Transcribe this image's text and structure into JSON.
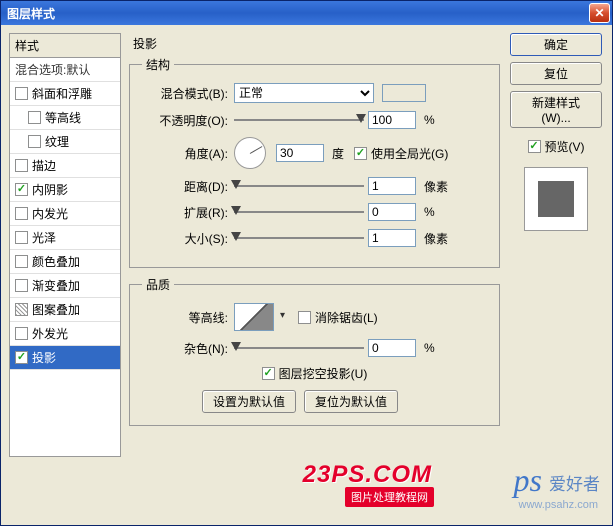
{
  "window": {
    "title": "图层样式"
  },
  "left": {
    "header": "样式",
    "blending_default": "混合选项:默认",
    "items": [
      {
        "label": "斜面和浮雕",
        "checked": false
      },
      {
        "label": "等高线",
        "checked": false,
        "sub": true
      },
      {
        "label": "纹理",
        "checked": false,
        "sub": true
      },
      {
        "label": "描边",
        "checked": false
      },
      {
        "label": "内阴影",
        "checked": true
      },
      {
        "label": "内发光",
        "checked": false
      },
      {
        "label": "光泽",
        "checked": false
      },
      {
        "label": "颜色叠加",
        "checked": false
      },
      {
        "label": "渐变叠加",
        "checked": false
      },
      {
        "label": "图案叠加",
        "checked": false,
        "pattern": true
      },
      {
        "label": "外发光",
        "checked": false
      },
      {
        "label": "投影",
        "checked": true,
        "selected": true
      }
    ]
  },
  "mid": {
    "section_title": "投影",
    "structure_legend": "结构",
    "blend_mode_label": "混合模式(B):",
    "blend_mode_value": "正常",
    "opacity_label": "不透明度(O):",
    "opacity_value": "100",
    "opacity_unit": "%",
    "angle_label": "角度(A):",
    "angle_value": "30",
    "angle_unit": "度",
    "global_light": "使用全局光(G)",
    "distance_label": "距离(D):",
    "distance_value": "1",
    "distance_unit": "像素",
    "spread_label": "扩展(R):",
    "spread_value": "0",
    "spread_unit": "%",
    "size_label": "大小(S):",
    "size_value": "1",
    "size_unit": "像素",
    "quality_legend": "品质",
    "contour_label": "等高线:",
    "anti_alias": "消除锯齿(L)",
    "noise_label": "杂色(N):",
    "noise_value": "0",
    "noise_unit": "%",
    "knockout": "图层挖空投影(U)",
    "make_default": "设置为默认值",
    "reset_default": "复位为默认值"
  },
  "right": {
    "ok": "确定",
    "cancel": "复位",
    "new_style": "新建样式(W)...",
    "preview": "预览(V)"
  },
  "chart_data": {
    "type": "table",
    "title": "投影 (Drop Shadow) 参数",
    "rows": [
      {
        "param": "混合模式",
        "value": "正常"
      },
      {
        "param": "不透明度",
        "value": 100,
        "unit": "%"
      },
      {
        "param": "角度",
        "value": 30,
        "unit": "度",
        "global_light": true
      },
      {
        "param": "距离",
        "value": 1,
        "unit": "像素"
      },
      {
        "param": "扩展",
        "value": 0,
        "unit": "%"
      },
      {
        "param": "大小",
        "value": 1,
        "unit": "像素"
      },
      {
        "param": "杂色",
        "value": 0,
        "unit": "%"
      },
      {
        "param": "消除锯齿",
        "value": false
      },
      {
        "param": "图层挖空投影",
        "value": true
      }
    ]
  },
  "watermarks": {
    "logo": "23PS.COM",
    "tag": "图片处理教程网",
    "ps": "ps",
    "text": "爱好者",
    "url": "www.psahz.com"
  }
}
